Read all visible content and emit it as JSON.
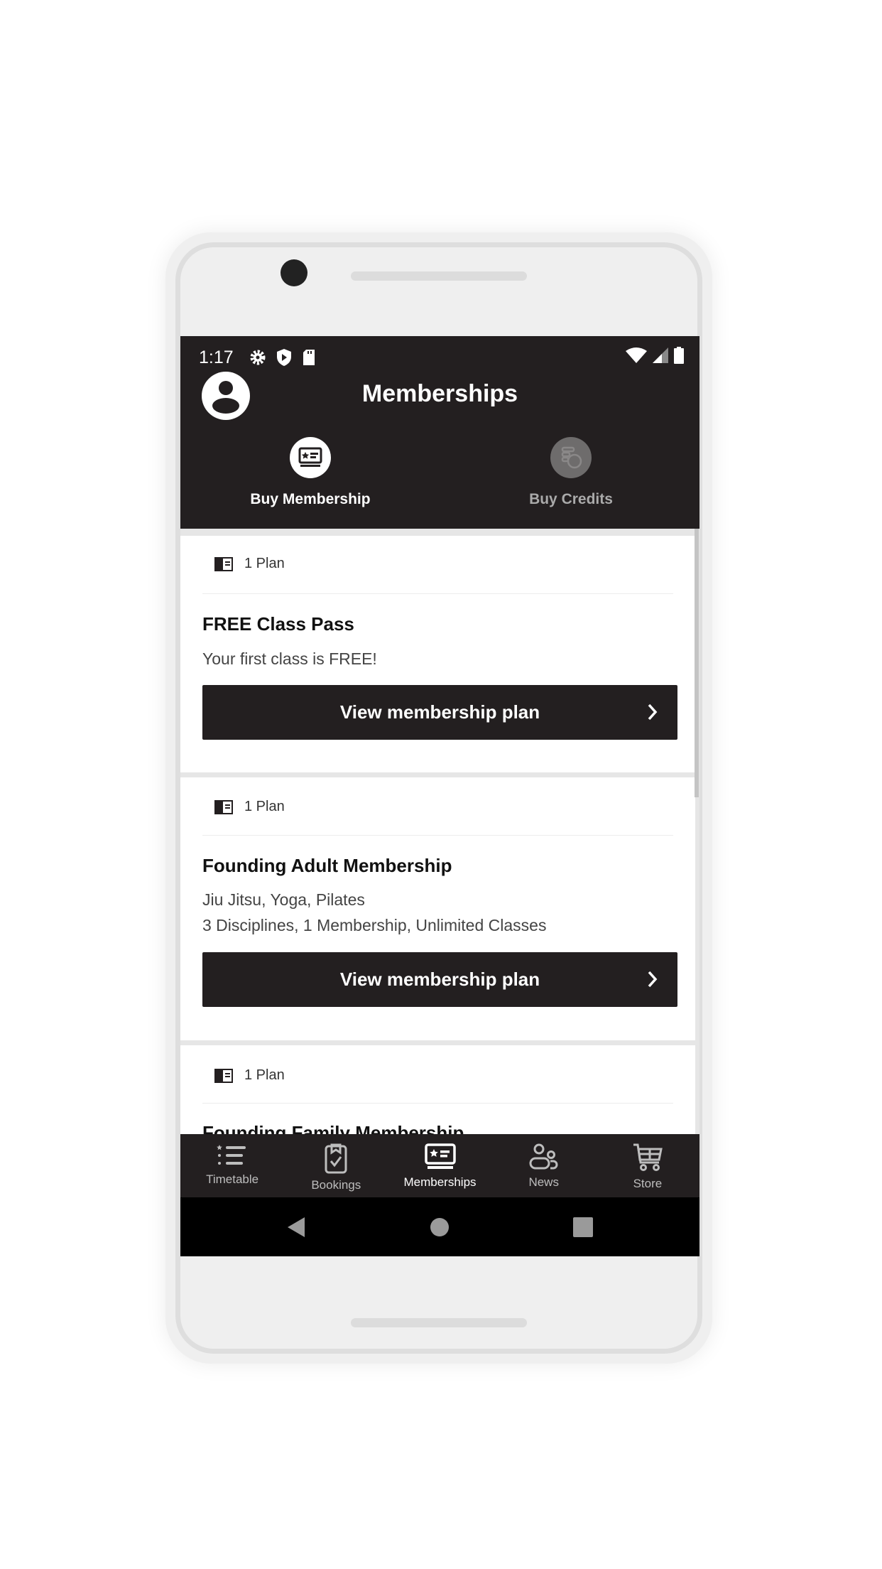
{
  "status_bar": {
    "time": "1:17",
    "icons": [
      "gear-icon",
      "shield-play-icon",
      "sd-card-icon",
      "wifi-icon",
      "signal-icon",
      "battery-icon"
    ]
  },
  "header": {
    "title": "Memberships",
    "tabs": [
      {
        "label": "Buy Membership",
        "icon": "membership-card-icon",
        "active": true
      },
      {
        "label": "Buy Credits",
        "icon": "credits-coins-icon",
        "active": false
      }
    ]
  },
  "cards": [
    {
      "plan_count": "1 Plan",
      "title": "FREE Class Pass",
      "description": [
        "Your first class is FREE!"
      ],
      "button": "View membership plan"
    },
    {
      "plan_count": "1 Plan",
      "title": "Founding Adult Membership",
      "description": [
        "Jiu Jitsu, Yoga, Pilates",
        "3 Disciplines, 1 Membership, Unlimited Classes"
      ],
      "button": "View membership plan"
    },
    {
      "plan_count": "1 Plan",
      "title": "Founding Family Membership"
    }
  ],
  "bottom_nav": [
    {
      "label": "Timetable",
      "icon": "timetable-list-icon"
    },
    {
      "label": "Bookings",
      "icon": "clipboard-check-icon"
    },
    {
      "label": "Memberships",
      "icon": "membership-card-icon",
      "active": true
    },
    {
      "label": "News",
      "icon": "people-icon"
    },
    {
      "label": "Store",
      "icon": "cart-icon"
    }
  ],
  "colors": {
    "header": "#231f20",
    "button": "#231f20",
    "inactive": "#bdbdbd"
  }
}
